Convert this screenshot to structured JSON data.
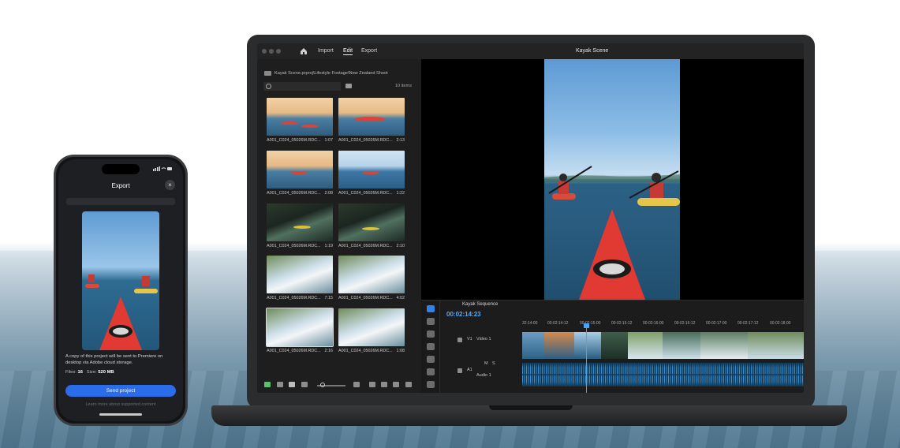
{
  "laptop": {
    "window_title": "Kayak Scene",
    "nav": {
      "import": "Import",
      "edit": "Edit",
      "export": "Export"
    },
    "media": {
      "breadcrumb": "Kayak Scene.prproj\\Lifestyle Footage\\New Zealand Shoot",
      "item_count": "10 items",
      "clips": [
        {
          "name": "A001_C024_05026M.RDC...",
          "duration": "1:07"
        },
        {
          "name": "A001_C024_05026M.RDC...",
          "duration": "2:13"
        },
        {
          "name": "A001_C024_05026M.RDC...",
          "duration": "2:08"
        },
        {
          "name": "A001_C024_05026M.RDC...",
          "duration": "1:22"
        },
        {
          "name": "A001_C024_05026M.RDC...",
          "duration": "1:19"
        },
        {
          "name": "A001_C024_05026M.RDC...",
          "duration": "2:10"
        },
        {
          "name": "A001_C024_05026M.RDC...",
          "duration": "7:15"
        },
        {
          "name": "A001_C024_05026M.RDC...",
          "duration": "4:02"
        },
        {
          "name": "A001_C024_05026M.RDC...",
          "duration": "2:16"
        },
        {
          "name": "A001_C024_05026M.RDC...",
          "duration": "1:08"
        }
      ]
    },
    "timeline": {
      "sequence_title": "Kayak Sequence",
      "timecode": "00:02:14:23",
      "ruler": [
        "32:14:00",
        "00:02:14:12",
        "00:02:15:00",
        "00:02:15:12",
        "00:02:16:00",
        "00:02:16:12",
        "00:02:17:00",
        "00:02:17:12",
        "00:02:18:00"
      ],
      "video_track": {
        "id": "V1",
        "name": "Video 1"
      },
      "audio_track": {
        "id": "A1",
        "name": "Audio 1",
        "mute": "M",
        "solo": "S"
      }
    }
  },
  "phone": {
    "sheet_title": "Export",
    "close": "×",
    "description": "A copy of this project will be sent to Premiere on desktop via Adobe cloud storage.",
    "files_label": "Files:",
    "files_value": "16",
    "size_label": "Size:",
    "size_value": "520 MB",
    "send_button": "Send project",
    "footer": "Learn more about supported content"
  },
  "colors": {
    "accent": "#2b6de8",
    "timecode": "#5aa7f5",
    "kayak": "#d9433a"
  }
}
